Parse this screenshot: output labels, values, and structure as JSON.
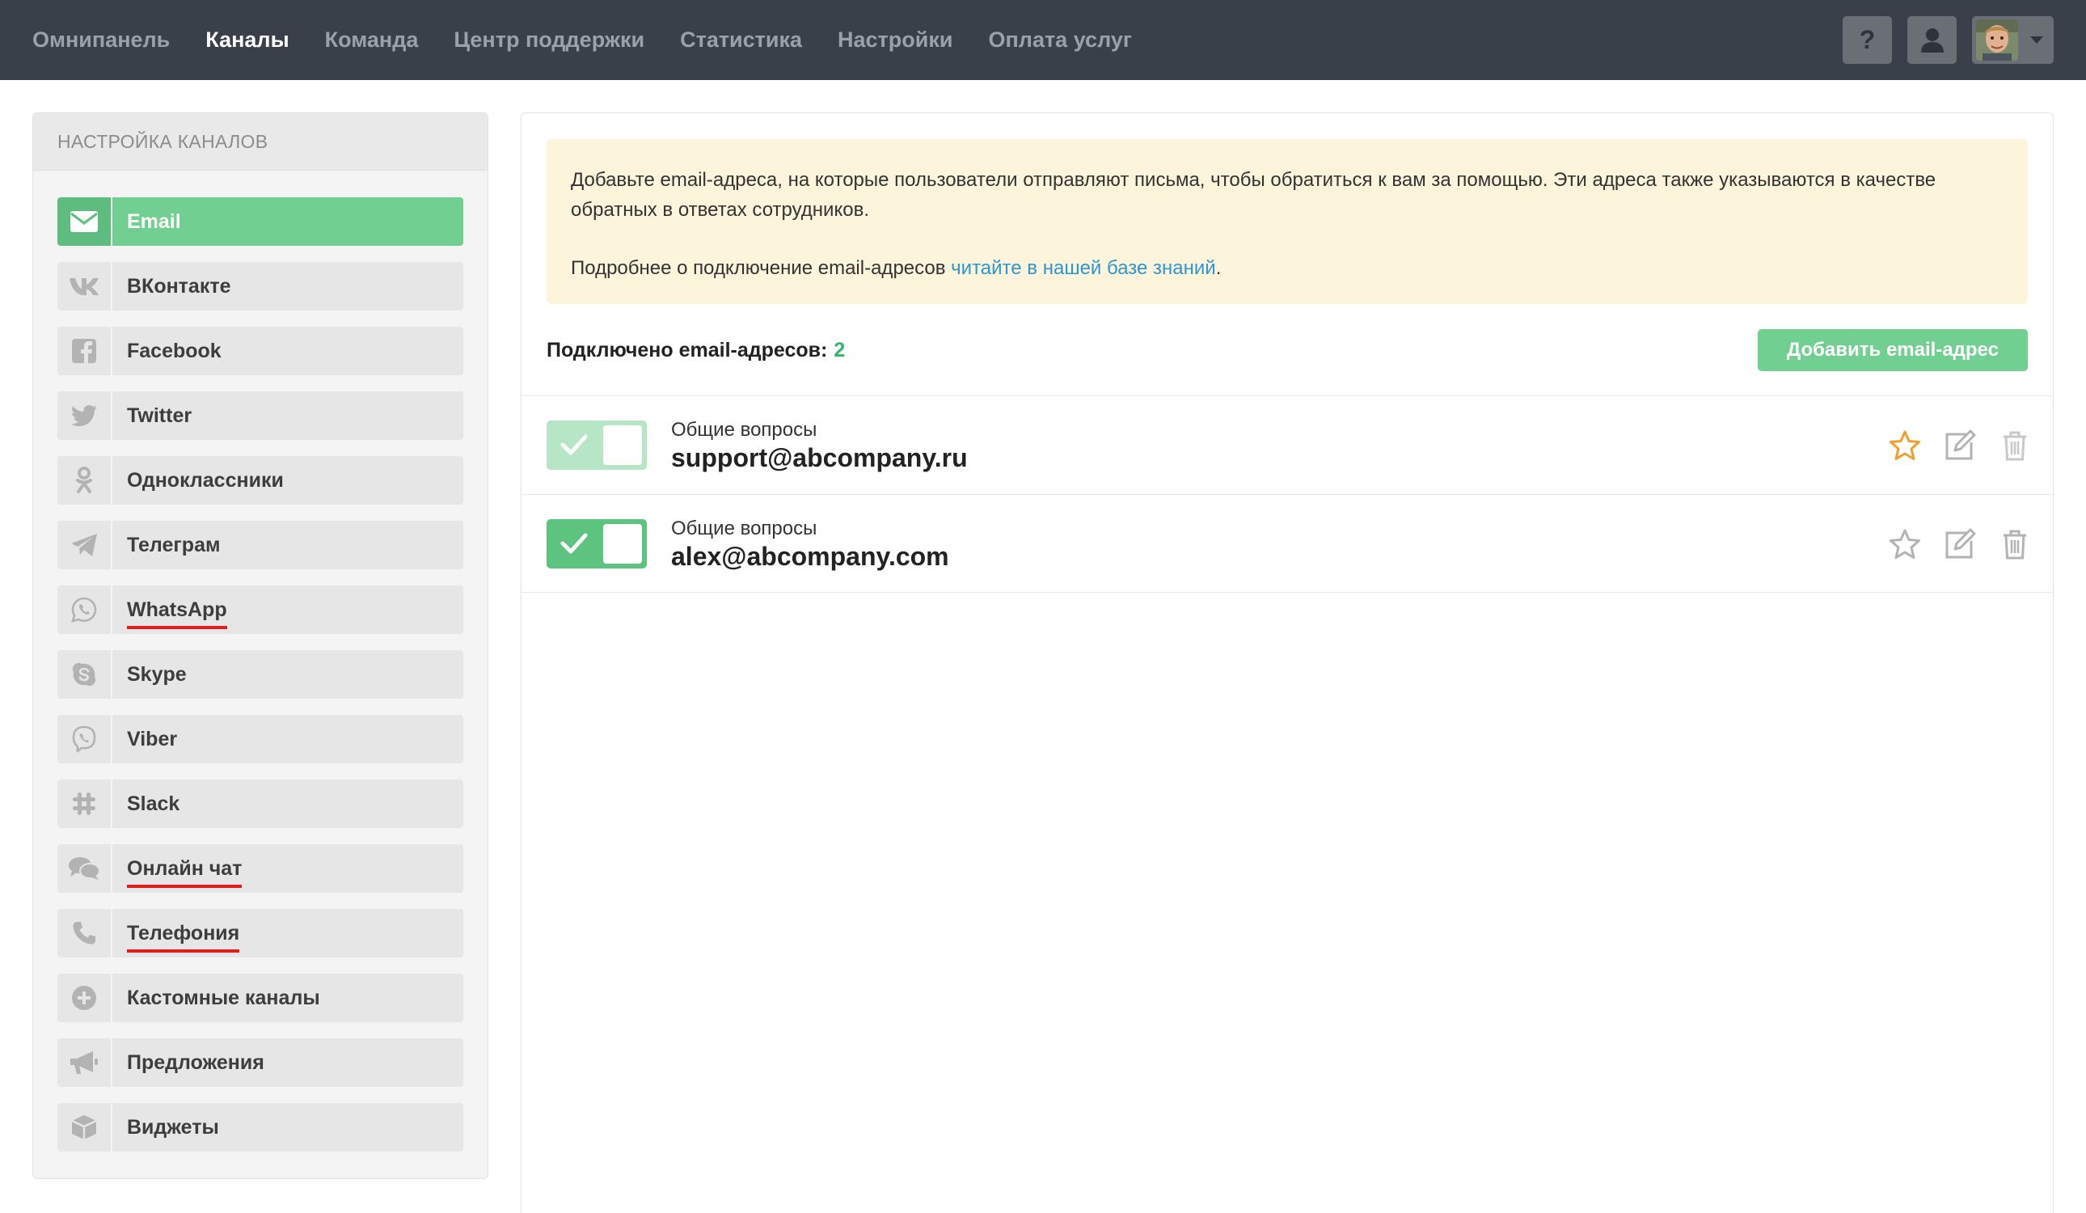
{
  "topnav": {
    "items": [
      {
        "label": "Омнипанель",
        "active": false
      },
      {
        "label": "Каналы",
        "active": true
      },
      {
        "label": "Команда",
        "active": false
      },
      {
        "label": "Центр поддержки",
        "active": false
      },
      {
        "label": "Статистика",
        "active": false
      },
      {
        "label": "Настройки",
        "active": false
      },
      {
        "label": "Оплата услуг",
        "active": false
      }
    ],
    "help_label": "?",
    "icons": [
      "question-icon",
      "user-icon",
      "avatar",
      "caret-down-icon"
    ]
  },
  "sidebar": {
    "title": "НАСТРОЙКА КАНАЛОВ",
    "items": [
      {
        "label": "Email",
        "icon": "envelope-icon",
        "active": true
      },
      {
        "label": "ВКонтакте",
        "icon": "vk-icon"
      },
      {
        "label": "Facebook",
        "icon": "facebook-icon"
      },
      {
        "label": "Twitter",
        "icon": "twitter-icon"
      },
      {
        "label": "Одноклассники",
        "icon": "odnoklassniki-icon"
      },
      {
        "label": "Телеграм",
        "icon": "telegram-icon"
      },
      {
        "label": "WhatsApp",
        "icon": "whatsapp-icon",
        "underlined": true
      },
      {
        "label": "Skype",
        "icon": "skype-icon"
      },
      {
        "label": "Viber",
        "icon": "viber-icon"
      },
      {
        "label": "Slack",
        "icon": "slack-icon"
      },
      {
        "label": "Онлайн чат",
        "icon": "chat-bubbles-icon",
        "underlined": true
      },
      {
        "label": "Телефония",
        "icon": "phone-icon",
        "underlined": true
      },
      {
        "label": "Кастомные каналы",
        "icon": "plus-circle-icon"
      },
      {
        "label": "Предложения",
        "icon": "megaphone-icon"
      },
      {
        "label": "Виджеты",
        "icon": "cube-icon"
      }
    ]
  },
  "main": {
    "notice": {
      "text1": "Добавьте email-адреса, на которые пользователи отправляют письма, чтобы обратиться к вам за помощью. Эти адреса также указываются в качестве обратных в ответах сотрудников.",
      "text2_prefix": "Подробнее о подключение email-адресов ",
      "text2_link": "читайте в нашей базе знаний",
      "text2_suffix": "."
    },
    "count_label": "Подключено email-адресов:",
    "count_value": "2",
    "add_button": "Добавить email-адрес",
    "emails": [
      {
        "group": "Общие вопросы",
        "address": "support@abcompany.ru",
        "enabled": true,
        "starred": true
      },
      {
        "group": "Общие вопросы",
        "address": "alex@abcompany.com",
        "enabled": true,
        "starred": false
      }
    ]
  },
  "colors": {
    "topbar": "#3a4049",
    "accent_green": "#72cf92",
    "link_blue": "#2d97cf",
    "notice_bg": "#fdf4dc",
    "star_active": "#f0a030",
    "underline_red": "#e01e1e"
  }
}
